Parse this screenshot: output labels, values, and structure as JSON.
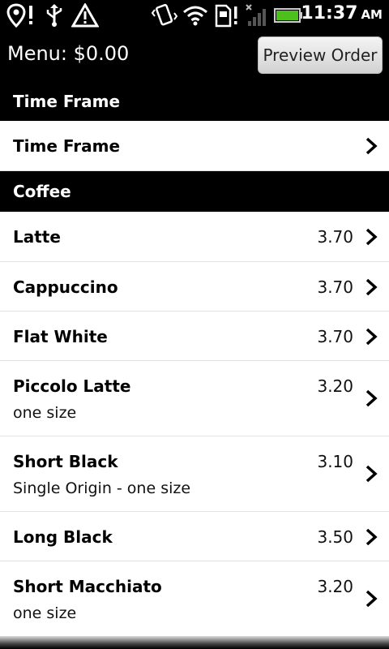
{
  "status_bar": {
    "time": "11:37",
    "ampm": "AM",
    "icons": [
      "location-alert-icon",
      "usb-icon",
      "warning-icon",
      "vibrate-icon",
      "wifi-icon",
      "sim-alert-icon",
      "signal-icon",
      "battery-icon"
    ]
  },
  "header": {
    "title": "Menu: $0.00",
    "preview_button": "Preview Order"
  },
  "sections": {
    "time_frame": {
      "header": "Time Frame",
      "row_label": "Time Frame"
    },
    "coffee": {
      "header": "Coffee",
      "items": [
        {
          "name": "Latte",
          "price": "3.70"
        },
        {
          "name": "Cappuccino",
          "price": "3.70"
        },
        {
          "name": "Flat White",
          "price": "3.70"
        },
        {
          "name": "Piccolo Latte",
          "price": "3.20",
          "sub": "one size"
        },
        {
          "name": "Short Black",
          "price": "3.10",
          "sub": "Single Origin - one size"
        },
        {
          "name": "Long Black",
          "price": "3.50"
        },
        {
          "name": "Short Macchiato",
          "price": "3.20",
          "sub": "one size"
        }
      ]
    }
  },
  "colors": {
    "bar_background": "#000000",
    "list_background": "#ffffff",
    "battery": "#4ec01e"
  }
}
